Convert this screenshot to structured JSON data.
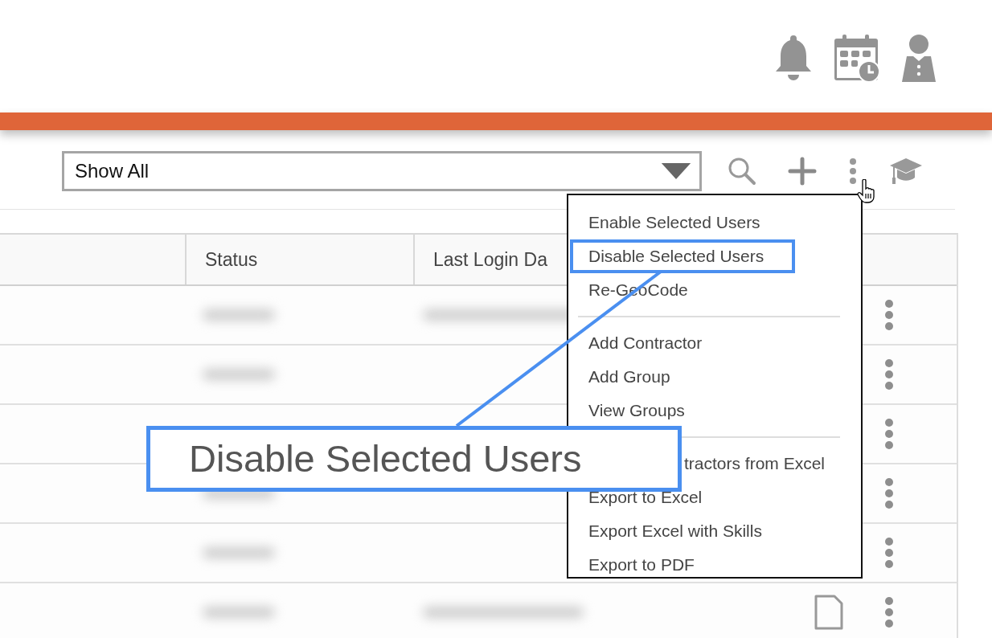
{
  "toolbar": {
    "filter_value": "Show All"
  },
  "table": {
    "columns": [
      "",
      "Status",
      "Last Login Da"
    ],
    "rows": [
      {
        "attachment": false
      },
      {
        "attachment": false
      },
      {
        "attachment": false
      },
      {
        "attachment": false
      },
      {
        "attachment": false
      },
      {
        "attachment": true
      }
    ]
  },
  "menu": {
    "groups": [
      {
        "items": [
          {
            "label": "Enable Selected Users",
            "highlighted": false
          },
          {
            "label": "Disable Selected Users",
            "highlighted": true
          },
          {
            "label": "Re-GeoCode",
            "highlighted": false
          }
        ]
      },
      {
        "items": [
          {
            "label": "Add Contractor",
            "highlighted": false
          },
          {
            "label": "Add Group",
            "highlighted": false
          },
          {
            "label": "View Groups",
            "highlighted": false
          }
        ]
      },
      {
        "items": [
          {
            "label": "tractors from Excel",
            "highlighted": false
          },
          {
            "label": "Export to Excel",
            "highlighted": false
          },
          {
            "label": "Export Excel with Skills",
            "highlighted": false
          },
          {
            "label": "Export to PDF",
            "highlighted": false
          }
        ]
      }
    ]
  },
  "callout": {
    "text": "Disable Selected Users"
  }
}
